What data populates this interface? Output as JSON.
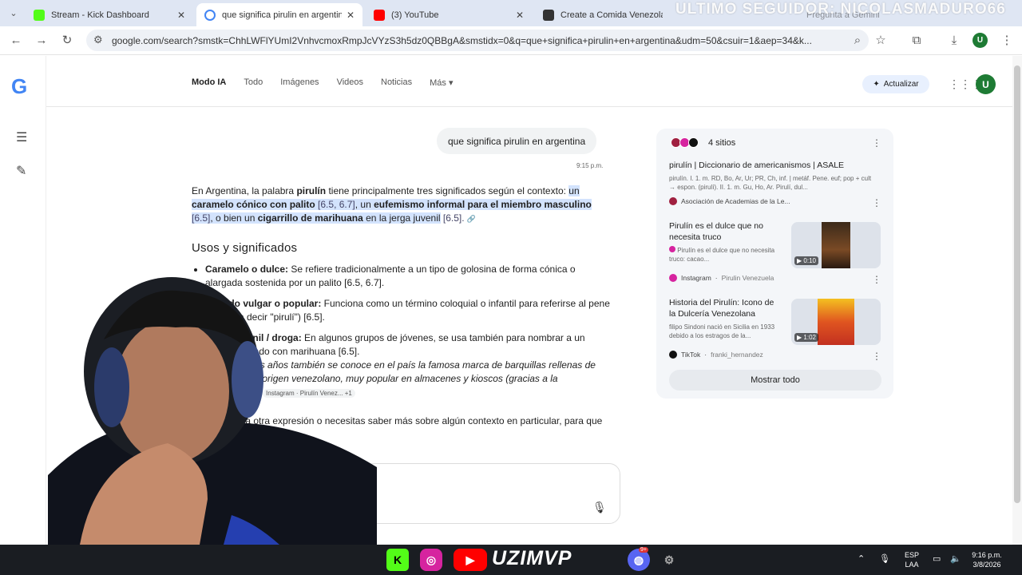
{
  "tabs": [
    {
      "title": "Stream - Kick Dashboard",
      "color": "#53fc18",
      "active": false
    },
    {
      "title": "que significa pirulin en argentina",
      "color": "#4285f4",
      "active": true
    },
    {
      "title": "(3) YouTube",
      "color": "#ff0000",
      "active": false
    },
    {
      "title": "Create a Comida Venezolana T",
      "color": "#333333",
      "active": false
    },
    {
      "title": "Pregunta a Gemini",
      "color": "#8ab4f8",
      "active": false
    }
  ],
  "stream_overlay": "ULTIMO SEGUIDOR: NICOLASMADURO66",
  "address_bar": {
    "url": "google.com/search?smstk=ChhLWFlYUmI2VnhvcmoxRmpJcVYzS3h5dz0QBBgA&smstidx=0&q=que+significa+pirulin+en+argentina&udm=50&csuir=1&aep=34&k..."
  },
  "profile_initial": "U",
  "nav": {
    "items": [
      "Modo IA",
      "Todo",
      "Imágenes",
      "Videos",
      "Noticias",
      "Más"
    ],
    "update_label": "Actualizar"
  },
  "chat": {
    "query": "que significa pirulin en argentina",
    "time": "9:15 p.m.",
    "intro": {
      "p1": "En Argentina, la palabra ",
      "b1": "pirulín",
      "p2": " tiene principalmente tres significados según el contexto: ",
      "h1": "un ",
      "hb1": "caramelo cónico con palito",
      "hr1": " [6.5, 6.7]",
      "hp1": ", un ",
      "hb2": "eufemismo informal para el miembro masculino",
      "hr2": " [6.5]",
      "hp2": ", o bien un ",
      "hb3": "cigarrillo de marihuana",
      "hp3": " en la jerga juvenil",
      "r3": " [6.5]."
    },
    "heading": "Usos y significados",
    "items": [
      {
        "term": "Caramelo o dulce:",
        "text": " Se refiere tradicionalmente a un tipo de golosina de forma cónica o alargada sostenida por un palito [6.5, 6.7]."
      },
      {
        "term": "Sentido vulgar o popular:",
        "text": " Funciona como un término coloquial o infantil para referirse al pene (similar a decir \"pirulí\") [6.5]."
      },
      {
        "term": "Jerga juvenil / droga:",
        "text": " En algunos grupos de jóvenes, se usa también para nombrar a un cigarro armado con marihuana [6.5]."
      }
    ],
    "italic_note": "En los últimos años también se conoce en el país la famosa marca de barquillas rellenas de chocolate de origen venezolano, muy popular en almacenes y kioscos (gracias a la inmigración).",
    "note_cite": "Instagram · Pirulín Venez... +1",
    "closing": "¿Te referías a otra expresión o necesitas saber más sobre algún contexto en particular, para que lo veamos."
  },
  "sources": {
    "count_label": "4 sitios",
    "cards": [
      {
        "title": "pirulín | Diccionario de americanismos | ASALE",
        "snippet": "pirulín. I. 1. m. RD, Bo, Ar, Ur; PR, Ch, inf. | metáf. Pene. euf; pop + cult → espon. (pirulí). II. 1. m. Gu, Ho, Ar. Pirulí, dul...",
        "source": "Asociación de Academias de la Le..."
      },
      {
        "title": "Pirulín es el dulce que no necesita truco",
        "snippet": "Pirulín es el dulce que no necesita truco: cacao...",
        "source": "Instagram",
        "handle": "Pirulin Venezuela",
        "duration": "0:10"
      },
      {
        "title": "Historia del Pirulín: Icono de la Dulcería Venezolana",
        "snippet": "filipo Sindoni nació en Sicilia en 1933 debido a los estragos de la...",
        "source": "TikTok",
        "handle": "franki_hernandez",
        "duration": "1:02"
      }
    ],
    "show_all": "Mostrar todo"
  },
  "taskbar": {
    "brand": "UZIMVP",
    "notif": "9+",
    "lang": "ESP",
    "lang2": "LAA",
    "time": "9:16 p.m.",
    "date": "3/8/2026"
  }
}
